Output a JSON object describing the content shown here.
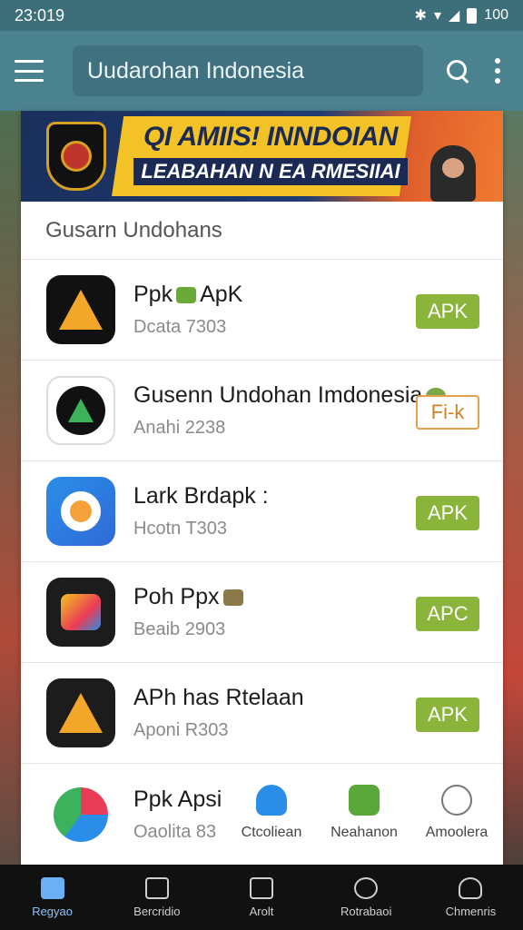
{
  "status_bar": {
    "time": "23:019",
    "battery_text": "100"
  },
  "app_bar": {
    "search_value": "Uudarohan Indonesia"
  },
  "banner": {
    "title": "QI AMIIS! INNDOIAN",
    "subtitle": "LEABAHAN N EA RMESIIAI"
  },
  "section_title": "Gusarn Undohans",
  "apps": [
    {
      "name": "Ppk",
      "name_suffix": "ApK",
      "subtitle": "Dcata 7303",
      "button": "APK",
      "icon": "ic-black"
    },
    {
      "name": "Gusenn Undohan  Imdonesia",
      "name_suffix": "",
      "subtitle": "Anahi 2238",
      "button": "Fi-k",
      "icon": "ic-white"
    },
    {
      "name": "Lark Brdapk :",
      "name_suffix": "",
      "subtitle": "Hcotn T303",
      "button": "APK",
      "icon": "ic-blue"
    },
    {
      "name": "Poh Ppx",
      "name_suffix": "",
      "subtitle": "Beaib 2903",
      "button": "APC",
      "icon": "ic-dark"
    },
    {
      "name": "APh has Rtelaan",
      "name_suffix": "",
      "subtitle": "Aponi R303",
      "button": "APK",
      "icon": "ic-dark"
    },
    {
      "name": "Ppk Apsi",
      "name_suffix": "",
      "subtitle": "Oaolita 83",
      "button": "",
      "icon": "ic-colorful"
    }
  ],
  "inner_tabs": [
    {
      "label": "Ctcoliean"
    },
    {
      "label": "Neahanon"
    },
    {
      "label": "Amoolera"
    }
  ],
  "bottom_nav": [
    {
      "label": "Regyao",
      "active": true
    },
    {
      "label": "Bercridio",
      "active": false
    },
    {
      "label": "Arolt",
      "active": false
    },
    {
      "label": "Rotrabaoi",
      "active": false
    },
    {
      "label": "Chmenris",
      "active": false
    }
  ],
  "colors": {
    "app_bar": "#4a8290",
    "status_bar": "#3d6f7a",
    "apk_green": "#8ab53a",
    "nav_active": "#6bb0f5"
  }
}
